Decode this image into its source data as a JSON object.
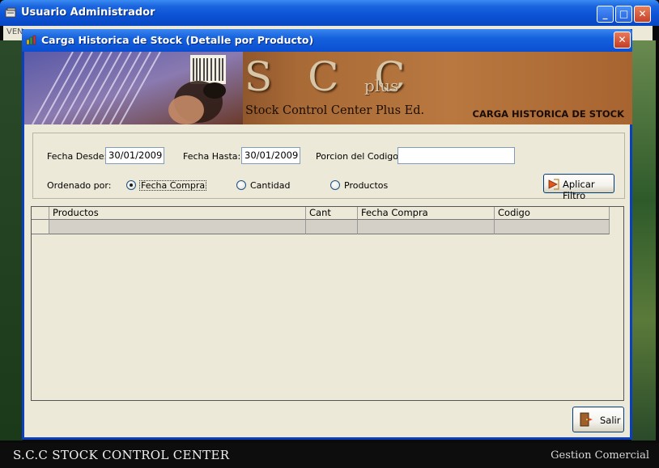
{
  "outer_window": {
    "title": "Usuario Administrador",
    "menu_fragment": "VEN",
    "min_glyph": "_",
    "max_glyph": "□",
    "close_glyph": "✕"
  },
  "dialog": {
    "title": "Carga Historica de Stock (Detalle por Producto)",
    "close_glyph": "✕"
  },
  "banner": {
    "logo_letters": "S C C",
    "logo_plus": "plus",
    "tagline": "Stock Control Center Plus Ed.",
    "caption": "CARGA HISTORICA DE STOCK"
  },
  "filters": {
    "fecha_desde_label": "Fecha Desde:",
    "fecha_desde_value": "30/01/2009",
    "fecha_hasta_label": "Fecha Hasta:",
    "fecha_hasta_value": "30/01/2009",
    "porcion_label": "Porcion del Codigo:",
    "porcion_value": "",
    "ordenado_label": "Ordenado por:",
    "options": [
      {
        "label": "Fecha Compra",
        "checked": true
      },
      {
        "label": "Cantidad",
        "checked": false
      },
      {
        "label": "Productos",
        "checked": false
      }
    ],
    "apply_button": "Aplicar Filtro"
  },
  "grid": {
    "columns": [
      "Productos",
      "Cant",
      "Fecha Compra",
      "Codigo"
    ]
  },
  "salir_button": "Salir",
  "status_bar": {
    "left": "S.C.C  STOCK CONTROL CENTER",
    "right": "Gestion Comercial"
  }
}
